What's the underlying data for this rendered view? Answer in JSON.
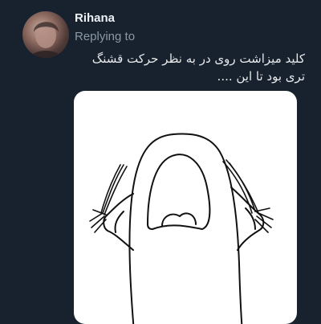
{
  "tweet": {
    "author_name": "Rihana",
    "replying_label": "Replying to",
    "text_line1": "کلید میزاشت روی در به نظر حرکت قشنگ",
    "text_line2": "تری بود تا این ....",
    "avatar_icon": "user-avatar",
    "media_icon": "screaming-cartoon-meme"
  },
  "colors": {
    "background": "#18222f",
    "primary_text": "#e7e9ea",
    "secondary_text": "#8b98a5",
    "media_background": "#ffffff"
  }
}
